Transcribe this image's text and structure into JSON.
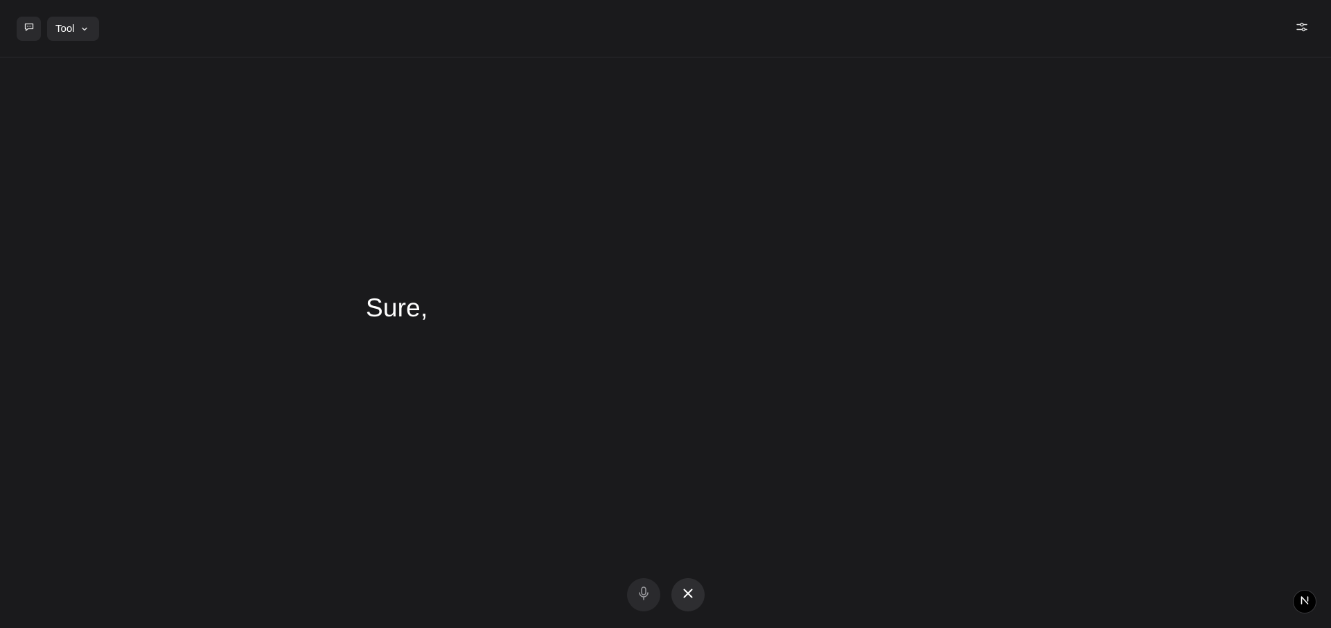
{
  "header": {
    "chat_icon": "chat-bubble-icon",
    "tool_selector": {
      "label": "Tool",
      "icon": "chevron-down-icon"
    },
    "settings_icon": "sliders-icon"
  },
  "main": {
    "transcript_text": "Sure,"
  },
  "controls": {
    "mic_icon": "microphone-icon",
    "close_icon": "close-icon"
  },
  "badge": {
    "icon": "n-logo-icon"
  },
  "colors": {
    "background": "#1a1a1c",
    "button_bg": "#2a2a2d",
    "text": "#ffffff",
    "divider": "#2a2a2d"
  }
}
